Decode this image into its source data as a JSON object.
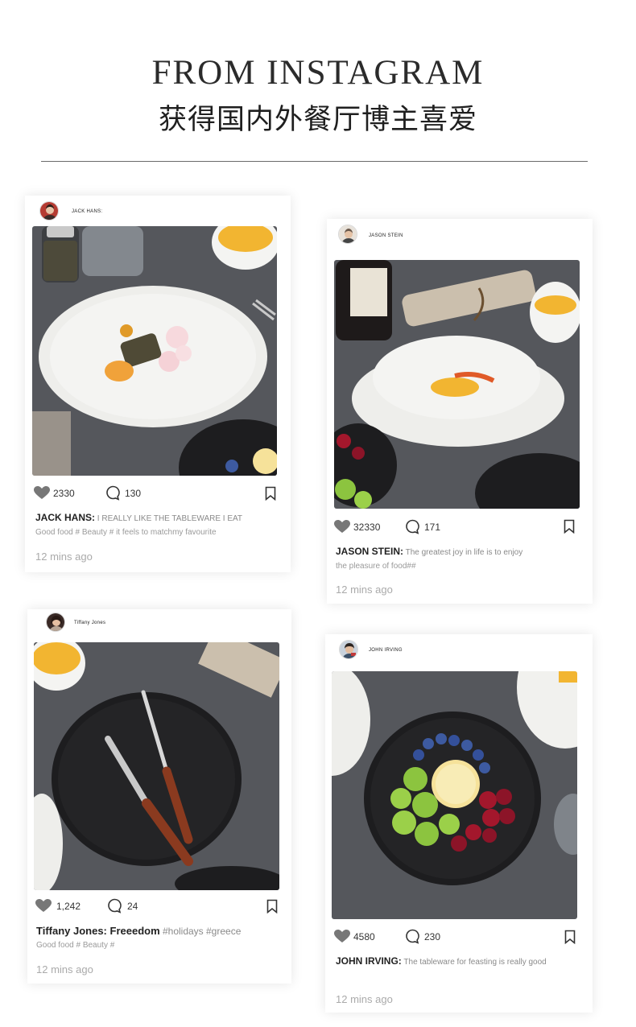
{
  "header": {
    "title": "FROM INSTAGRAM",
    "subtitle": "获得国内外餐厅博主喜爱"
  },
  "posts": [
    {
      "username": "JACK HANS:",
      "likes": "2330",
      "comments": "130",
      "caption_name": "JACK HANS:",
      "caption_text": " I REALLY LIKE THE TABLEWARE I EAT",
      "caption_line2": "Good food # Beauty #   it feels to matchmy favourite",
      "time": "12 mins ago"
    },
    {
      "username": "JASON STEIN",
      "likes": "32330",
      "comments": "171",
      "caption_name": "JASON STEIN:",
      "caption_text": " The greatest joy in life is to enjoy",
      "caption_line2": "the pleasure of food##",
      "time": "12 mins ago"
    },
    {
      "username": "Tiffany Jones",
      "likes": "1,242",
      "comments": "24",
      "caption_name": "Tiffany Jones: Freeedom",
      "caption_text": " #holidays #greece",
      "caption_line2": "Good food # Beauty #",
      "time": "12 mins ago"
    },
    {
      "username": "JOHN IRVING",
      "likes": "4580",
      "comments": "230",
      "caption_name": "JOHN IRVING:",
      "caption_text": " The tableware for feasting is really good",
      "caption_line2": "",
      "time": "12 mins ago"
    }
  ],
  "icons": {
    "like": "heart-icon",
    "comment": "comment-bubble-icon",
    "save": "bookmark-icon"
  },
  "colors": {
    "table": "#55575c",
    "plate_white": "#f1f1ee",
    "plate_black": "#1c1c1e",
    "yolk": "#f2b531",
    "caption_grey": "#8a8a8a"
  }
}
